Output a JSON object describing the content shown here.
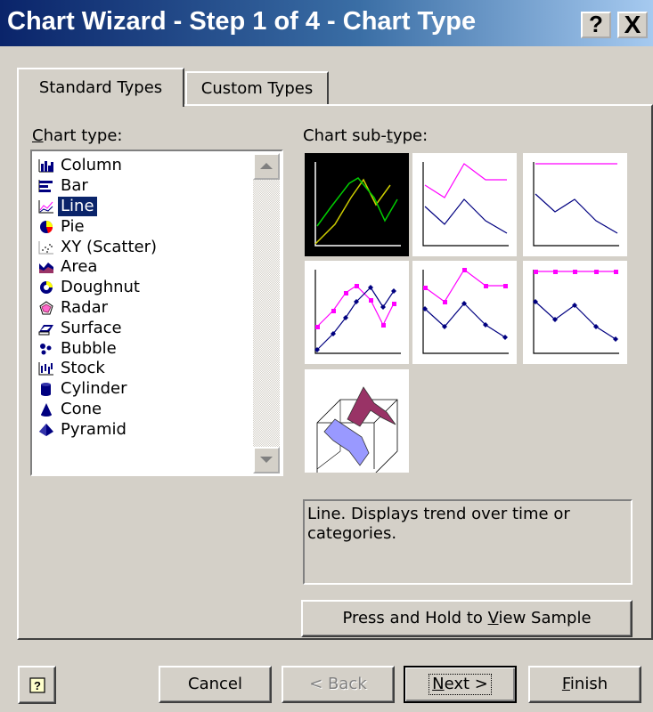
{
  "window": {
    "title": "Chart Wizard - Step 1 of 4 - Chart Type",
    "help_glyph": "?",
    "close_glyph": "X"
  },
  "tabs": [
    {
      "label": "Standard Types",
      "active": true
    },
    {
      "label": "Custom Types",
      "active": false
    }
  ],
  "chart_type": {
    "label_pre": "",
    "label_access": "C",
    "label_post": "hart type:",
    "items": [
      {
        "label": "Column",
        "icon": "column-chart-icon"
      },
      {
        "label": "Bar",
        "icon": "bar-chart-icon"
      },
      {
        "label": "Line",
        "icon": "line-chart-icon",
        "selected": true
      },
      {
        "label": "Pie",
        "icon": "pie-chart-icon"
      },
      {
        "label": "XY (Scatter)",
        "icon": "scatter-chart-icon"
      },
      {
        "label": "Area",
        "icon": "area-chart-icon"
      },
      {
        "label": "Doughnut",
        "icon": "doughnut-chart-icon"
      },
      {
        "label": "Radar",
        "icon": "radar-chart-icon"
      },
      {
        "label": "Surface",
        "icon": "surface-chart-icon"
      },
      {
        "label": "Bubble",
        "icon": "bubble-chart-icon"
      },
      {
        "label": "Stock",
        "icon": "stock-chart-icon"
      },
      {
        "label": "Cylinder",
        "icon": "cylinder-chart-icon"
      },
      {
        "label": "Cone",
        "icon": "cone-chart-icon"
      },
      {
        "label": "Pyramid",
        "icon": "pyramid-chart-icon"
      }
    ]
  },
  "chart_subtype": {
    "label_pre": "Chart sub-",
    "label_access": "t",
    "label_post": "ype:",
    "selected_index": 0,
    "count": 7
  },
  "description": "Line. Displays trend over time or categories.",
  "buttons": {
    "sample_pre": "Press and Hold to ",
    "sample_access": "V",
    "sample_post": "iew Sample",
    "help_glyph": "?",
    "cancel": "Cancel",
    "back": "< Back",
    "next_access": "N",
    "next_post": "ext >",
    "finish_access": "F",
    "finish_post": "inish"
  },
  "colors": {
    "titlebar_start": "#0a246a",
    "selection": "#0a246a",
    "series_pink": "#ff00ff",
    "series_navy": "#000080",
    "series_green": "#00cc00",
    "series_yellow": "#cccc00"
  }
}
